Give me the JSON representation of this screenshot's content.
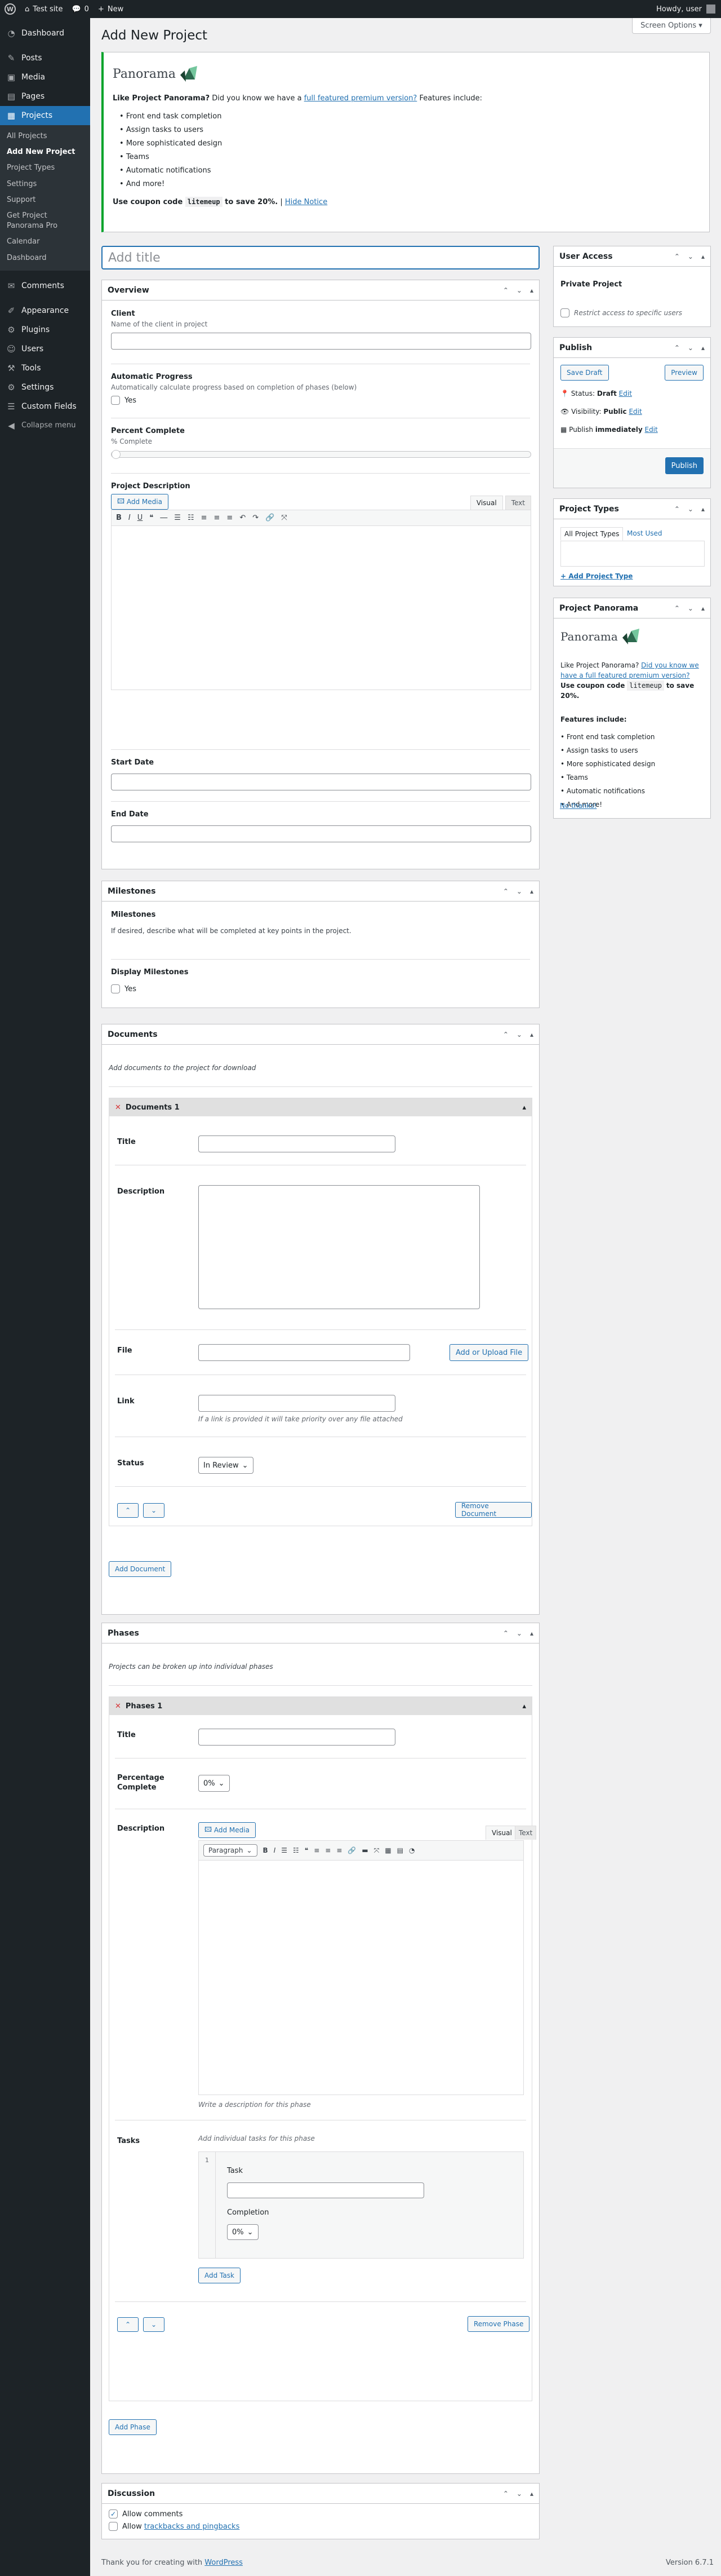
{
  "admin_bar": {
    "site_name": "Test site",
    "comments_count": "0",
    "new_label": "New",
    "howdy": "Howdy, user"
  },
  "menu": {
    "items": [
      {
        "label": "Dashboard",
        "icon": "dashboard-icon"
      },
      {
        "label": "Posts",
        "icon": "pin-icon"
      },
      {
        "label": "Media",
        "icon": "media-icon"
      },
      {
        "label": "Pages",
        "icon": "pages-icon"
      },
      {
        "label": "Projects",
        "icon": "projects-icon"
      }
    ],
    "projects_sub": [
      "All Projects",
      "Add New Project",
      "Project Types",
      "Settings",
      "Support",
      "Get Project Panorama Pro",
      "Calendar",
      "Dashboard"
    ],
    "items_after": [
      {
        "label": "Comments",
        "icon": "comments-icon"
      },
      {
        "label": "Appearance",
        "icon": "brush-icon"
      },
      {
        "label": "Plugins",
        "icon": "plugin-icon"
      },
      {
        "label": "Users",
        "icon": "users-icon"
      },
      {
        "label": "Tools",
        "icon": "wrench-icon"
      },
      {
        "label": "Settings",
        "icon": "settings-icon"
      },
      {
        "label": "Custom Fields",
        "icon": "fields-icon"
      },
      {
        "label": "Collapse menu",
        "icon": "collapse-icon"
      }
    ]
  },
  "page": {
    "title": "Add New Project",
    "screen_options": "Screen Options ▾",
    "title_placeholder": "Add title"
  },
  "notice": {
    "logo_text": "Panorama",
    "lead_bold": "Like Project Panorama?",
    "lead_text": " Did you know we have a ",
    "lead_link": "full featured premium version?",
    "lead_tail": " Features include:",
    "features": [
      "Front end task completion",
      "Assign tasks to users",
      "More sophisticated design",
      "Teams",
      "Automatic notifications",
      "And more!"
    ],
    "coupon_pre": "Use coupon code",
    "coupon_code": "litemeup",
    "coupon_post": "to save 20%.",
    "hide": "Hide Notice"
  },
  "overview": {
    "title": "Overview",
    "client_label": "Client",
    "client_desc": "Name of the client in project",
    "auto_label": "Automatic Progress",
    "auto_desc": "Automatically calculate progress based on completion of phases (below)",
    "yes": "Yes",
    "percent_label": "Percent Complete",
    "percent_sub": "% Complete",
    "percent_value": 0,
    "desc_label": "Project Description",
    "add_media": "Add Media",
    "tab_visual": "Visual",
    "tab_text": "Text",
    "start_label": "Start Date",
    "end_label": "End Date"
  },
  "milestones": {
    "title": "Milestones",
    "label": "Milestones",
    "desc": "If desired, describe what will be completed at key points in the project.",
    "display_label": "Display Milestones",
    "yes": "Yes"
  },
  "documents": {
    "title": "Documents",
    "intro": "Add documents to the project for download",
    "item_title": "Documents 1",
    "f_title": "Title",
    "f_desc": "Description",
    "f_file": "File",
    "upload": "Add or Upload File",
    "f_link": "Link",
    "link_hint": "If a link is provided it will take priority over any file attached",
    "f_status": "Status",
    "status_value": "In Review",
    "remove": "Remove Document",
    "add": "Add Document"
  },
  "phases": {
    "title": "Phases",
    "intro": "Projects can be broken up into individual phases",
    "item_title": "Phases 1",
    "f_title": "Title",
    "f_pct": "Percentage Complete",
    "pct_value": "0%",
    "f_desc": "Description",
    "add_media": "Add Media",
    "tab_visual": "Visual",
    "tab_text": "Text",
    "paragraph": "Paragraph",
    "desc_hint": "Write a description for this phase",
    "f_tasks": "Tasks",
    "tasks_hint": "Add individual tasks for this phase",
    "task_num": "1",
    "task_label": "Task",
    "completion_label": "Completion",
    "completion_value": "0%",
    "add_task": "Add Task",
    "remove": "Remove Phase",
    "add": "Add Phase"
  },
  "discussion": {
    "title": "Discussion",
    "allow_comments": "Allow comments",
    "allow_tb_pre": "Allow ",
    "allow_tb_link": "trackbacks and pingbacks"
  },
  "user_access": {
    "title": "User Access",
    "private": "Private Project",
    "restrict": "Restrict access to specific users"
  },
  "publish": {
    "title": "Publish",
    "save_draft": "Save Draft",
    "preview": "Preview",
    "status_pre": "Status:",
    "status_val": "Draft",
    "visibility_pre": "Visibility:",
    "visibility_val": "Public",
    "publish_pre": "Publish",
    "publish_val": "immediately",
    "edit": "Edit",
    "publish_btn": "Publish"
  },
  "project_types": {
    "title": "Project Types",
    "tab_all": "All Project Types",
    "tab_most": "Most Used",
    "add_new": "+ Add Project Type"
  },
  "panorama_box": {
    "title": "Project Panorama",
    "logo_text": "Panorama",
    "lead_bold": "Like Project Panorama?",
    "lead_link": "Did you know we have a full featured premium version?",
    "use": "Use",
    "coupon_pre": "coupon code",
    "coupon_code": "litemeup",
    "coupon_post": "to save 20%.",
    "features_label": "Features include:",
    "features": [
      "Front end task completion",
      "Assign tasks to users",
      "More sophisticated design",
      "Teams",
      "Automatic notifications",
      "And more!"
    ],
    "no_thanks": "No thanks!"
  },
  "footer": {
    "thanks_pre": "Thank you for creating with ",
    "thanks_link": "WordPress",
    "version": "Version 6.7.1"
  }
}
